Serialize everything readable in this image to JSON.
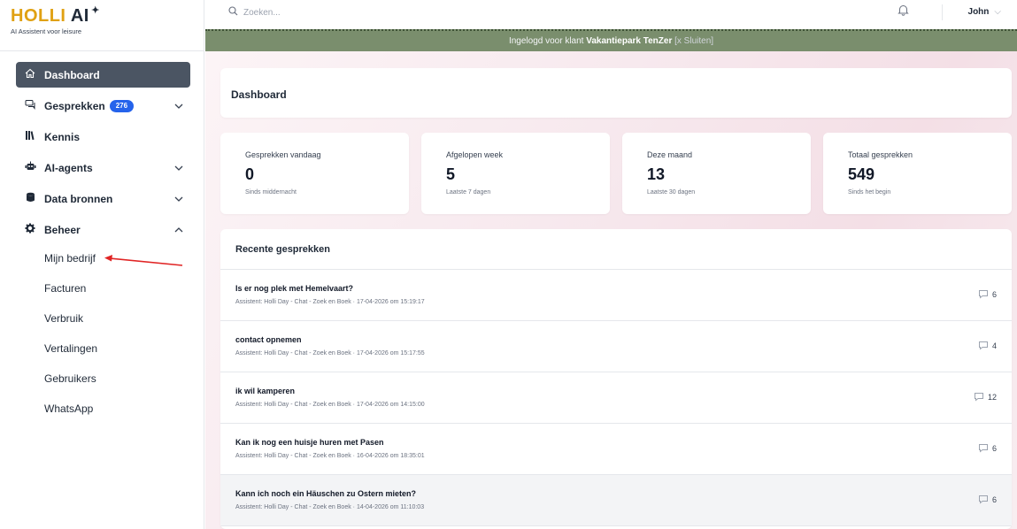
{
  "brand": {
    "name_part1": "HOLLI",
    "name_part2": "AI",
    "subtitle": "AI Assistent voor leisure"
  },
  "search": {
    "placeholder": "Zoeken..."
  },
  "user": {
    "name": "John"
  },
  "banner": {
    "prefix": "Ingelogd voor klant",
    "client": "Vakantiepark TenZer",
    "close": "[x Sluiten]"
  },
  "sidebar": {
    "items": [
      {
        "label": "Dashboard",
        "icon": "home-icon"
      },
      {
        "label": "Gesprekken",
        "icon": "chat-icon",
        "badge": "276"
      },
      {
        "label": "Kennis",
        "icon": "books-icon"
      },
      {
        "label": "AI-agents",
        "icon": "robot-icon"
      },
      {
        "label": "Data bronnen",
        "icon": "database-icon"
      },
      {
        "label": "Beheer",
        "icon": "gear-icon"
      }
    ],
    "sub_items": [
      "Mijn bedrijf",
      "Facturen",
      "Verbruik",
      "Vertalingen",
      "Gebruikers",
      "WhatsApp"
    ]
  },
  "dashboard": {
    "title": "Dashboard"
  },
  "stats": [
    {
      "label": "Gesprekken vandaag",
      "value": "0",
      "sub": "Sinds middernacht"
    },
    {
      "label": "Afgelopen week",
      "value": "5",
      "sub": "Laatste 7 dagen"
    },
    {
      "label": "Deze maand",
      "value": "13",
      "sub": "Laatste 30 dagen"
    },
    {
      "label": "Totaal gesprekken",
      "value": "549",
      "sub": "Sinds het begin"
    }
  ],
  "recent": {
    "title": "Recente gesprekken",
    "rows": [
      {
        "title": "Is er nog plek met Hemelvaart?",
        "meta": "Assistent: Holli Day - Chat - Zoek en Boek  ·  17-04-2026 om 15:19:17",
        "count": "6"
      },
      {
        "title": "contact opnemen",
        "meta": "Assistent: Holli Day - Chat - Zoek en Boek  ·  17-04-2026 om 15:17:55",
        "count": "4"
      },
      {
        "title": "ik wil kamperen",
        "meta": "Assistent: Holli Day - Chat - Zoek en Boek  ·  17-04-2026 om 14:15:00",
        "count": "12"
      },
      {
        "title": "Kan ik nog een huisje huren met Pasen",
        "meta": "Assistent: Holli Day - Chat - Zoek en Boek  ·  16-04-2026 om 18:35:01",
        "count": "6"
      },
      {
        "title": "Kann ich noch ein Häuschen zu Ostern mieten?",
        "meta": "Assistent: Holli Day - Chat - Zoek en Boek  ·  14-04-2026 om 11:10:03",
        "count": "6"
      }
    ]
  },
  "colors": {
    "accent": "#2563eb",
    "brand": "#e0a113",
    "banner": "#7a8e6d",
    "active_nav": "#4b5563",
    "annotation_arrow": "#e02424"
  }
}
